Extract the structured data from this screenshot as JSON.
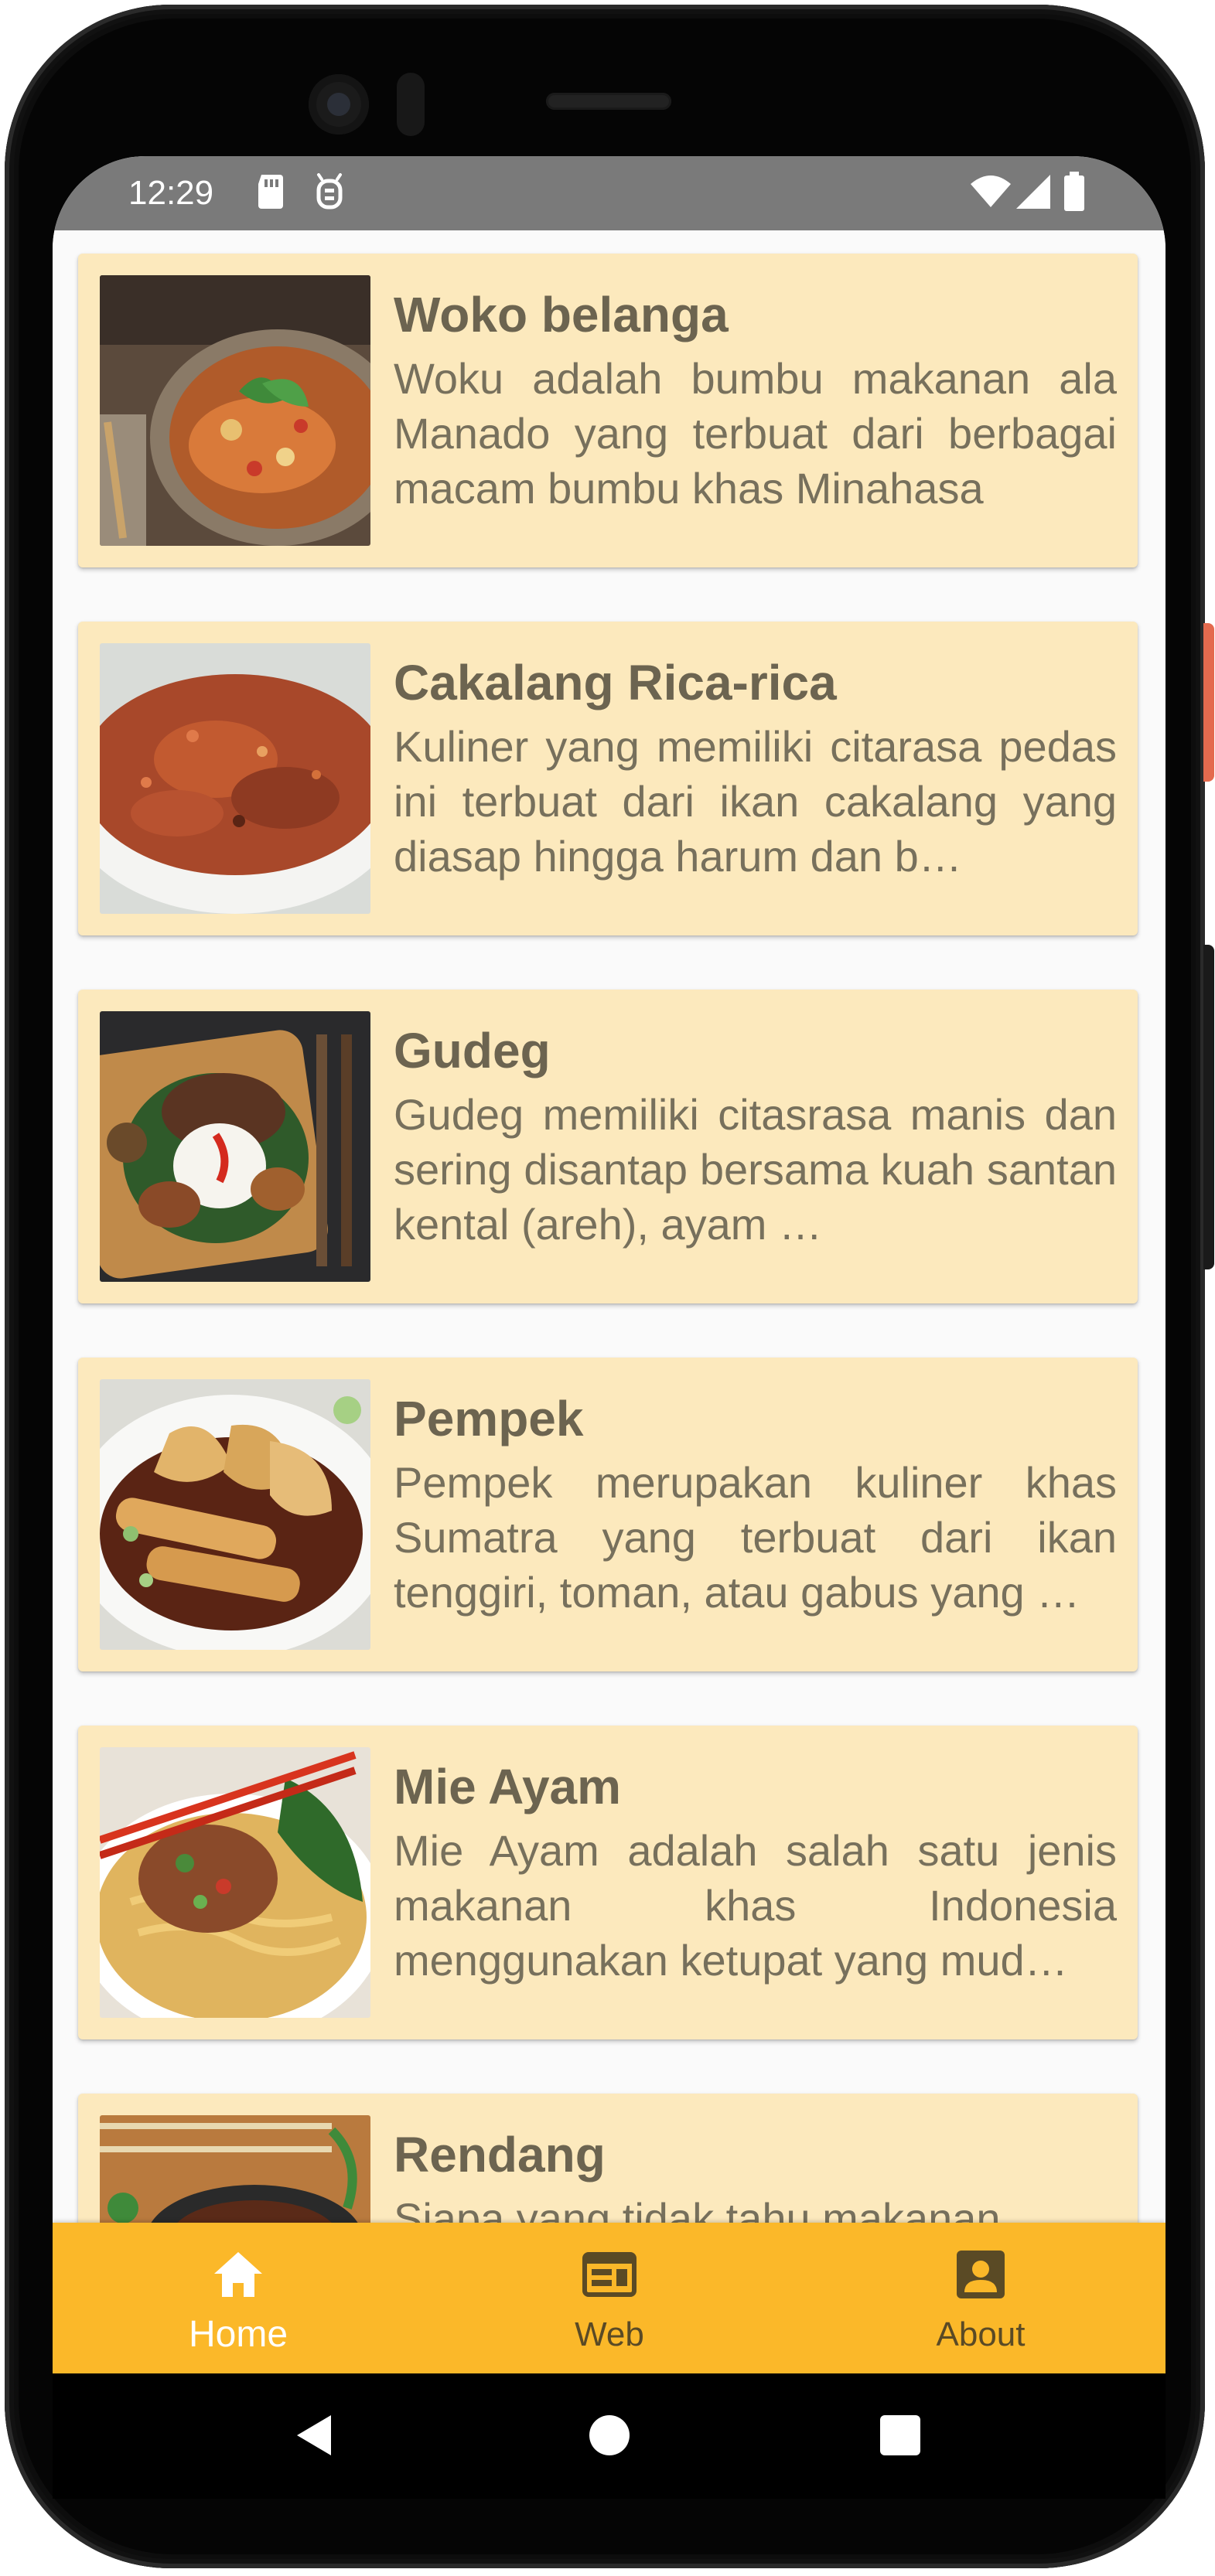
{
  "status_bar": {
    "time": "12:29",
    "icons_left": [
      "sd-card-icon",
      "sim-debug-icon"
    ],
    "icons_right": [
      "wifi-icon",
      "cellular-signal-icon",
      "battery-icon"
    ]
  },
  "list": {
    "items": [
      {
        "title": "Woko belanga",
        "description": "Woku adalah bumbu makanan ala Manado yang terbuat dari berbagai macam bumbu khas Minahasa",
        "image": "woku-dish"
      },
      {
        "title": "Cakalang Rica-rica",
        "description": "Kuliner yang memiliki citarasa pedas ini terbuat dari ikan cakalang yang diasap hingga harum dan b…",
        "image": "cakalang-dish"
      },
      {
        "title": "Gudeg",
        "description": "Gudeg memiliki citasrasa manis dan sering disantap bersama kuah santan kental (areh), ayam …",
        "image": "gudeg-dish"
      },
      {
        "title": "Pempek",
        "description": "Pempek merupakan kuliner khas Sumatra yang terbuat dari ikan tenggiri, toman, atau gabus yang …",
        "image": "pempek-dish"
      },
      {
        "title": "Mie Ayam",
        "description": "Mie Ayam adalah salah satu jenis makanan khas Indonesia menggunakan ketupat yang mud…",
        "image": "mie-ayam-dish"
      },
      {
        "title": "Rendang",
        "description": "Siapa yang tidak tahu makanan",
        "image": "rendang-dish"
      }
    ]
  },
  "bottom_nav": {
    "items": [
      {
        "label": "Home",
        "icon": "home-icon",
        "active": true
      },
      {
        "label": "Web",
        "icon": "web-icon",
        "active": false
      },
      {
        "label": "About",
        "icon": "account-box-icon",
        "active": false
      }
    ]
  },
  "colors": {
    "card_background": "#fce9bd",
    "bottom_nav_background": "#fbb829",
    "status_bar_background": "#7a7a7a",
    "title_text": "#6c6450",
    "description_text": "#77705c"
  }
}
